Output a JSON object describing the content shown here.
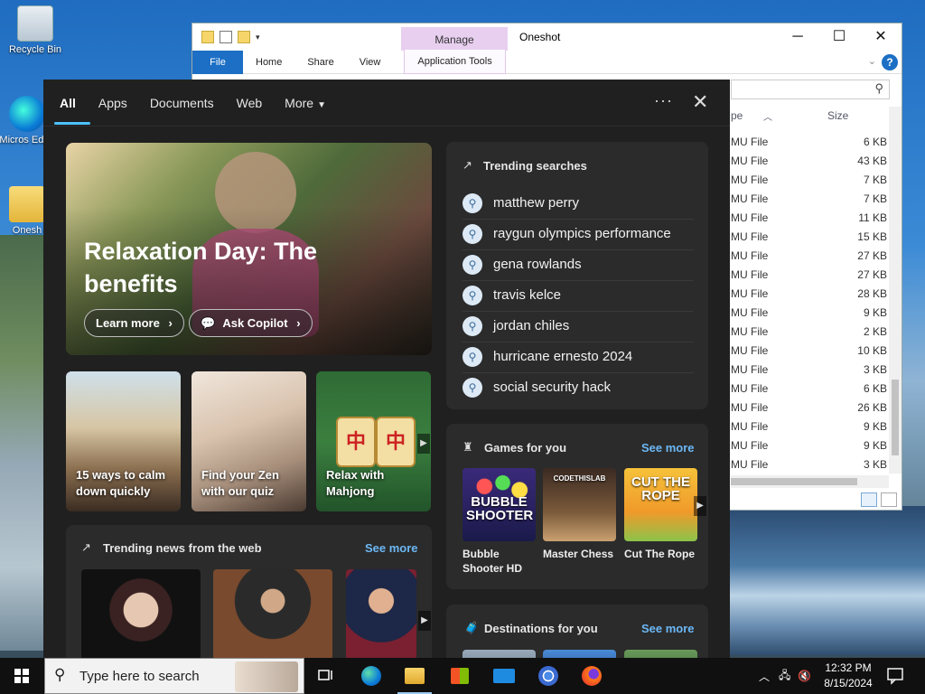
{
  "desktop": {
    "icons": [
      {
        "label": "Recycle Bin"
      },
      {
        "label": "Micros Edge"
      },
      {
        "label": "Onesh"
      }
    ]
  },
  "explorer": {
    "manage_tab": "Manage",
    "title": "Oneshot",
    "window_buttons": [
      "─",
      "☐",
      "✕"
    ],
    "ribbon_tabs": {
      "file": "File",
      "home": "Home",
      "share": "Share",
      "view": "View",
      "application_tools": "Application Tools"
    },
    "help": "?",
    "columns": {
      "type": "pe",
      "size": "Size"
    },
    "rows": [
      {
        "type": "MU File",
        "size": "6 KB"
      },
      {
        "type": "MU File",
        "size": "43 KB"
      },
      {
        "type": "MU File",
        "size": "7 KB"
      },
      {
        "type": "MU File",
        "size": "7 KB"
      },
      {
        "type": "MU File",
        "size": "11 KB"
      },
      {
        "type": "MU File",
        "size": "15 KB"
      },
      {
        "type": "MU File",
        "size": "27 KB"
      },
      {
        "type": "MU File",
        "size": "27 KB"
      },
      {
        "type": "MU File",
        "size": "28 KB"
      },
      {
        "type": "MU File",
        "size": "9 KB"
      },
      {
        "type": "MU File",
        "size": "2 KB"
      },
      {
        "type": "MU File",
        "size": "10 KB"
      },
      {
        "type": "MU File",
        "size": "3 KB"
      },
      {
        "type": "MU File",
        "size": "6 KB"
      },
      {
        "type": "MU File",
        "size": "26 KB"
      },
      {
        "type": "MU File",
        "size": "9 KB"
      },
      {
        "type": "MU File",
        "size": "9 KB"
      },
      {
        "type": "MU File",
        "size": "3 KB"
      }
    ]
  },
  "search_panel": {
    "tabs": [
      "All",
      "Apps",
      "Documents",
      "Web",
      "More"
    ],
    "active_tab": "All",
    "hero": {
      "title": "Relaxation Day: The benefits",
      "learn_more": "Learn more",
      "ask_copilot": "Ask Copilot"
    },
    "cards": [
      {
        "label": "15 ways to calm down quickly"
      },
      {
        "label": "Find your Zen with our quiz"
      },
      {
        "label": "Relax with Mahjong"
      }
    ],
    "trending_news": {
      "title": "Trending news from the web",
      "see_more": "See more"
    },
    "trending_searches": {
      "title": "Trending searches",
      "items": [
        "matthew perry",
        "raygun olympics performance",
        "gena rowlands",
        "travis kelce",
        "jordan chiles",
        "hurricane ernesto 2024",
        "social security hack"
      ]
    },
    "games": {
      "title": "Games for you",
      "see_more": "See more",
      "items": [
        {
          "name": "Bubble Shooter HD",
          "art": "BUBBLE SHOOTER"
        },
        {
          "name": "Master Chess",
          "art": "CODETHISLAB"
        },
        {
          "name": "Cut The Rope",
          "art": "CUT THE ROPE"
        }
      ]
    },
    "destinations": {
      "title": "Destinations for you",
      "see_more": "See more"
    }
  },
  "taskbar": {
    "search_placeholder": "Type here to search",
    "time": "12:32 PM",
    "date": "8/15/2024"
  },
  "colors": {
    "panel_bg": "#202020",
    "card_bg": "#2b2b2b",
    "accent": "#4cc2ff",
    "link": "#6cb8f6",
    "file_tab": "#1c6fc4",
    "manage_tab": "#e8cff0"
  }
}
